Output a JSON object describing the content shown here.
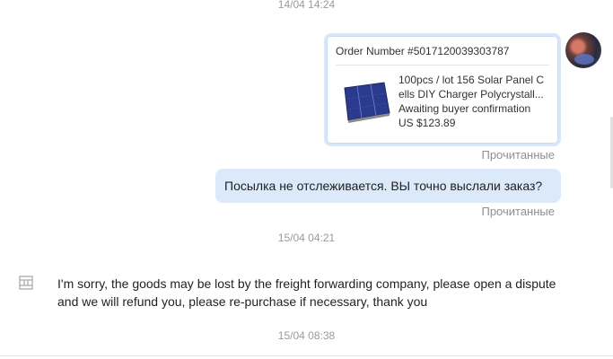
{
  "timestamps": {
    "t1": "14/04 14:24",
    "t2": "15/04 04:21",
    "t3": "15/04 08:38"
  },
  "order_card": {
    "order_number": "Order Number #5017120039303787",
    "product_title_line1": "100pcs / lot 156 Solar Panel C",
    "product_title_line2": "ells DIY Charger Polycrystall...",
    "status": "Awaiting buyer confirmation",
    "price": "US $123.89",
    "image_icon": "solar-panel-image"
  },
  "read_status": {
    "label1": "Прочитанные",
    "label2": "Прочитанные"
  },
  "buyer_message": "Посылка не отслеживается. ВЫ точно выслали заказ?",
  "seller_message": "I'm sorry, the goods may be lost by the freight forwarding company, please open a dispute and we will refund you, please re-purchase if necessary, thank you",
  "colors": {
    "bubble_out": "#dbe9fb",
    "card_border": "#c9dcf7",
    "timestamp": "#9a9a9a"
  }
}
